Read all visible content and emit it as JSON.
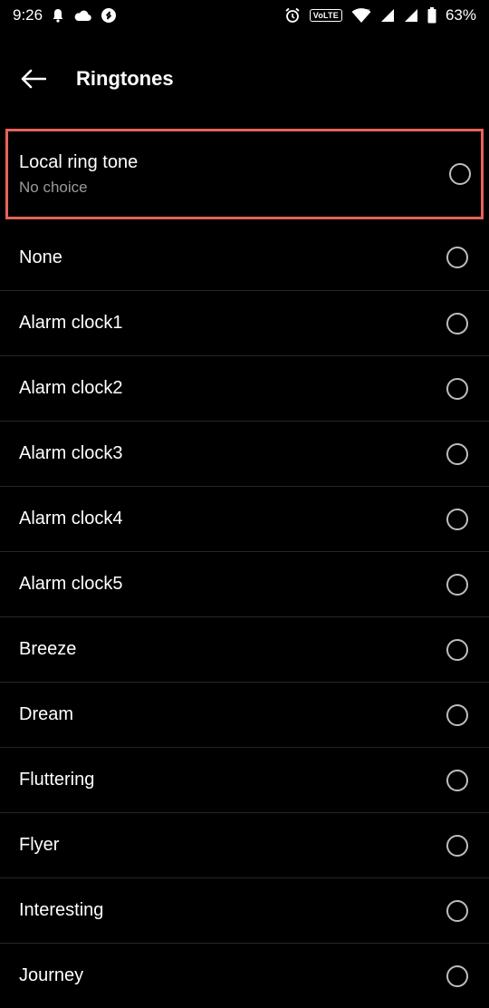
{
  "status_bar": {
    "time": "9:26",
    "volte": "VoLTE",
    "battery": "63%",
    "icons": [
      "notification-bell-icon",
      "cloud-icon",
      "shazam-icon",
      "alarm-icon",
      "wifi-icon",
      "signal-icon",
      "signal-icon-2",
      "battery-icon"
    ]
  },
  "app_bar": {
    "title": "Ringtones",
    "back_icon": "back-arrow-icon"
  },
  "first_item": {
    "label": "Local ring tone",
    "sub": "No choice"
  },
  "items": [
    {
      "label": "None"
    },
    {
      "label": "Alarm clock1"
    },
    {
      "label": "Alarm clock2"
    },
    {
      "label": "Alarm clock3"
    },
    {
      "label": "Alarm clock4"
    },
    {
      "label": "Alarm clock5"
    },
    {
      "label": "Breeze"
    },
    {
      "label": "Dream"
    },
    {
      "label": "Fluttering"
    },
    {
      "label": "Flyer"
    },
    {
      "label": "Interesting"
    },
    {
      "label": "Journey"
    }
  ],
  "colors": {
    "background": "#000000",
    "highlight": "#e8625a",
    "radio": "#bdbdbd"
  }
}
